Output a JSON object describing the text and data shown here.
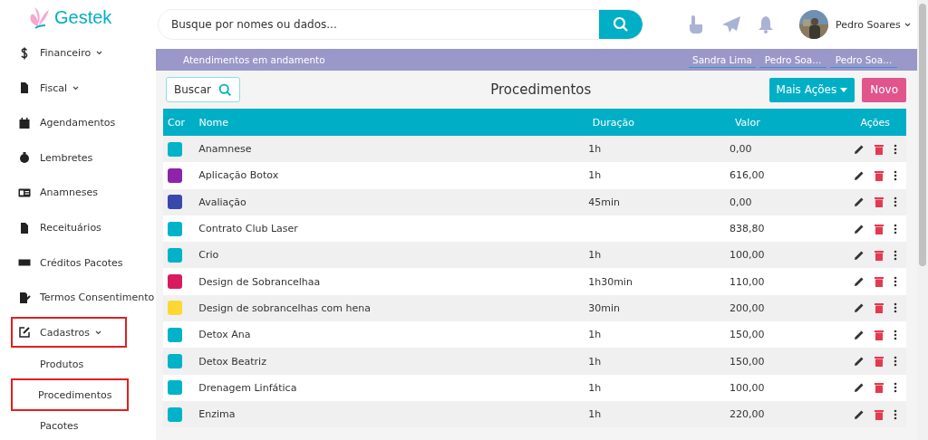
{
  "logo": {
    "text": "Gestek"
  },
  "search": {
    "placeholder": "Busque por nomes ou dados..."
  },
  "user": {
    "name": "Pedro Soares"
  },
  "sidebar": {
    "items": [
      {
        "label": "Financeiro",
        "dropdown": true,
        "highlighted": false
      },
      {
        "label": "Fiscal",
        "dropdown": true,
        "highlighted": false
      },
      {
        "label": "Agendamentos",
        "dropdown": false,
        "highlighted": false
      },
      {
        "label": "Lembretes",
        "dropdown": false,
        "highlighted": false
      },
      {
        "label": "Anamneses",
        "dropdown": false,
        "highlighted": false
      },
      {
        "label": "Receituários",
        "dropdown": false,
        "highlighted": false
      },
      {
        "label": "Créditos Pacotes",
        "dropdown": false,
        "highlighted": false
      },
      {
        "label": "Termos Consentimento",
        "dropdown": false,
        "highlighted": false
      },
      {
        "label": "Cadastros",
        "dropdown": true,
        "highlighted": true,
        "children": [
          {
            "label": "Produtos",
            "highlighted": false
          },
          {
            "label": "Procedimentos",
            "highlighted": true
          },
          {
            "label": "Pacotes",
            "highlighted": false
          }
        ]
      }
    ]
  },
  "attendance_bar": {
    "title": "Atendimentos em andamento",
    "people": [
      "Sandra Lima",
      "Pedro Soa...",
      "Pedro Soa..."
    ]
  },
  "toolbar": {
    "search_button": "Buscar",
    "title": "Procedimentos",
    "more_actions": "Mais Ações",
    "new_button": "Novo"
  },
  "table": {
    "columns": [
      "Cor",
      "Nome",
      "Duração",
      "Valor",
      "Ações"
    ],
    "rows": [
      {
        "color": "#00b3c8",
        "name": "Anamnese",
        "duration": "1h",
        "value": "0,00"
      },
      {
        "color": "#8e24aa",
        "name": "Aplicação Botox",
        "duration": "1h",
        "value": "616,00"
      },
      {
        "color": "#3949ab",
        "name": "Avaliação",
        "duration": "45min",
        "value": "0,00"
      },
      {
        "color": "#00b3c8",
        "name": "Contrato Club Laser",
        "value": "838,80"
      },
      {
        "color": "#00b3c8",
        "name": "Crio",
        "duration": "1h",
        "value": "100,00"
      },
      {
        "color": "#d81b60",
        "name": "Design de Sobrancelhaa",
        "duration": "1h30min",
        "value": "110,00"
      },
      {
        "color": "#fdd835",
        "name": "Design de sobrancelhas com hena",
        "duration": "30min",
        "value": "200,00"
      },
      {
        "color": "#00b3c8",
        "name": "Detox Ana",
        "duration": "1h",
        "value": "150,00"
      },
      {
        "color": "#00b3c8",
        "name": "Detox Beatriz",
        "duration": "1h",
        "value": "150,00"
      },
      {
        "color": "#00b3c8",
        "name": "Drenagem Linfática",
        "duration": "1h",
        "value": "100,00"
      },
      {
        "color": "#00b3c8",
        "name": "Enzima",
        "duration": "1h",
        "value": "220,00"
      }
    ]
  }
}
